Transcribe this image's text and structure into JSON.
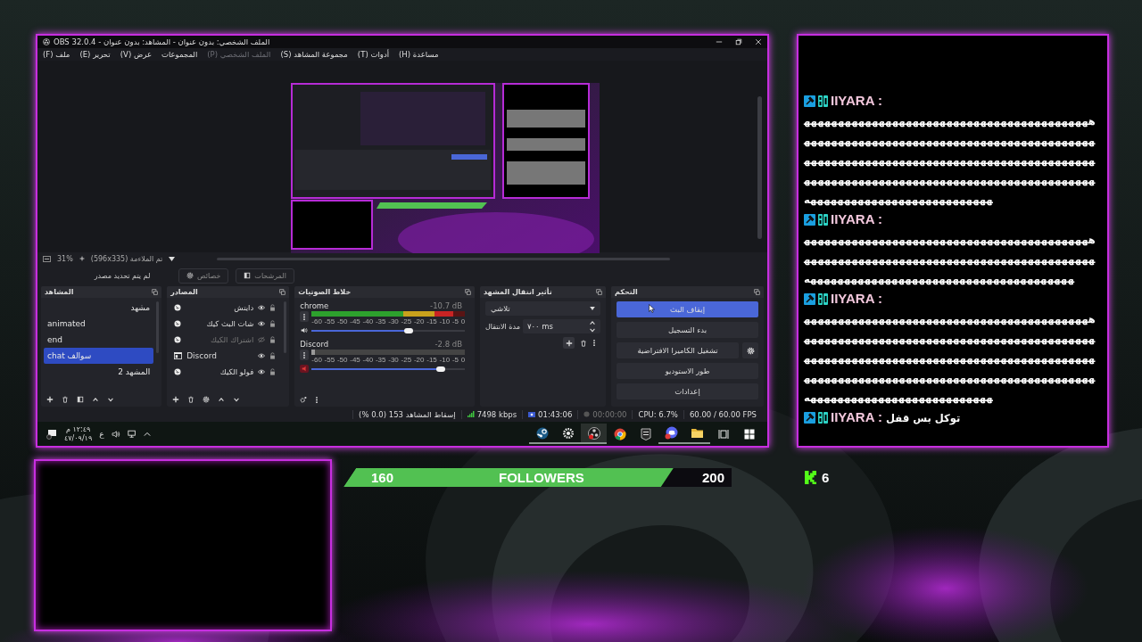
{
  "obs_window": {
    "title": "الملف الشخصي: بدون عنوان - المشاهد: بدون عنوان - OBS 32.0.4",
    "menu": [
      {
        "label": "مساعدة (H)",
        "disabled": false
      },
      {
        "label": "أدوات (T)",
        "disabled": false
      },
      {
        "label": "مجموعة المشاهد (S)",
        "disabled": false
      },
      {
        "label": "الملف الشخصي (P)",
        "disabled": true
      },
      {
        "label": "المجموعات",
        "disabled": false
      },
      {
        "label": "عرض (V)",
        "disabled": false
      },
      {
        "label": "تحرير (E)",
        "disabled": false
      },
      {
        "label": "ملف (F)",
        "disabled": false
      }
    ],
    "zoom": {
      "percent": "31%",
      "fit": "تم الملاءمة (596x335)"
    },
    "source_toolbar": {
      "status": "لم يتم تحديد مصدر",
      "buttons": [
        {
          "kind": "filters",
          "label": "المرشحات"
        },
        {
          "kind": "properties",
          "label": "خصائص"
        }
      ]
    },
    "scenes": {
      "title": "المشاهد",
      "items": [
        {
          "label": "مشهد",
          "selected": false
        },
        {
          "label": "animated",
          "selected": false
        },
        {
          "label": "end",
          "selected": false
        },
        {
          "label": "chat سوالف",
          "selected": true
        },
        {
          "label": "المشهد 2",
          "selected": false
        }
      ]
    },
    "sources": {
      "title": "المصادر",
      "items": [
        {
          "kind": "browser",
          "label": "دايتش",
          "visible": true
        },
        {
          "kind": "browser",
          "label": "شات البث كيك",
          "visible": true
        },
        {
          "kind": "browser",
          "label": "اشتراك الكيك",
          "visible": false
        },
        {
          "kind": "window",
          "label": "Discord",
          "visible": true
        },
        {
          "kind": "browser",
          "label": "فولو الكيك",
          "visible": true
        }
      ]
    },
    "mixer": {
      "title": "خلاط الصوتيات",
      "channels": [
        {
          "name": "chrome",
          "reading": "-10.7 dB",
          "muted": false,
          "meter": {
            "level": 0.92
          },
          "volume": {
            "level": 0.63
          },
          "scale": [
            "0",
            "-5",
            "-10",
            "-15",
            "-20",
            "-25",
            "-30",
            "-35",
            "-40",
            "-45",
            "-50",
            "-55",
            "-60"
          ]
        },
        {
          "name": "Discord",
          "reading": "-2.8 dB",
          "muted": true,
          "meter": {
            "level": 0.02
          },
          "volume": {
            "level": 0.84
          },
          "scale": [
            "0",
            "-5",
            "-10",
            "-15",
            "-20",
            "-25",
            "-30",
            "-35",
            "-40",
            "-45",
            "-50",
            "-55",
            "-60"
          ]
        }
      ]
    },
    "transitions": {
      "title": "تأثير انتقال المشهد",
      "transition": "تلاشي",
      "duration_label": "مدة الانتقال",
      "duration": "٧٠٠ ms"
    },
    "controls": {
      "title": "التحكم",
      "buttons": [
        {
          "label": "إيقاف البث",
          "active": true,
          "settings": false
        },
        {
          "label": "بدء التسجيل",
          "active": false,
          "settings": false
        },
        {
          "label": "تشغيل الكاميرا الافتراضية",
          "active": false,
          "settings": true
        },
        {
          "label": "طور الاستوديو",
          "active": false,
          "settings": false
        },
        {
          "label": "إعدادات",
          "active": false,
          "settings": false
        }
      ]
    },
    "status": {
      "dropped": "إسقاط المشاهد 153 (0.0 %)",
      "bitrate": "7498 kbps",
      "stream_time": "01:43:06",
      "record_time": "00:00:00",
      "cpu": "CPU: 6.7%",
      "fps": "60.00 / 60.00 FPS"
    },
    "taskbar": {
      "time": "١٢:٤٩ م",
      "date": "٤٧/٠٩/١٩",
      "language": "ع",
      "apps": [
        {
          "kind": "steam",
          "running": true,
          "selected": false
        },
        {
          "kind": "steelseries",
          "running": true,
          "selected": false
        },
        {
          "kind": "obs",
          "running": true,
          "selected": true
        },
        {
          "kind": "chrome",
          "running": false,
          "selected": false
        },
        {
          "kind": "epic",
          "running": false,
          "selected": false
        },
        {
          "kind": "discord",
          "running": true,
          "selected": false
        },
        {
          "kind": "folder",
          "running": true,
          "selected": false
        },
        {
          "kind": "taskview",
          "running": false,
          "selected": false
        },
        {
          "kind": "start",
          "running": false,
          "selected": false
        }
      ]
    }
  },
  "chat": {
    "messages": [
      {
        "name": "IIYARA :",
        "text": "هههههههههههههههههههههههههههههههههههههههههههههههههههههههههههههههههههههههههههههههههههههههههههههههههههههههههههههههههههههههههههههههههههههههههههههههههههههههههههههههههههههههههههههههههههههههههههههههههههههههه"
      },
      {
        "name": "IIYARA :",
        "text": "هههههههههههههههههههههههههههههههههههههههههههههههههههههههههههههههههههههههههههههههههههههههههههههههههههههههههههههههههههههههههههههه"
      },
      {
        "name": "IIYARA :",
        "text": "هههههههههههههههههههههههههههههههههههههههههههههههههههههههههههههههههههههههههههههههههههههههههههههههههههههههههههههههههههههههههههههههههههههههههههههههههههههههههههههههههههههههههههههههههههههههههههههههههههههههه"
      },
      {
        "name": "IIYARA :",
        "text": "توكل بس قفل"
      }
    ]
  },
  "followers": {
    "current": "160",
    "label": "FOLLOWERS",
    "goal": "200",
    "level": 0.85
  },
  "kick": {
    "count": "6"
  }
}
